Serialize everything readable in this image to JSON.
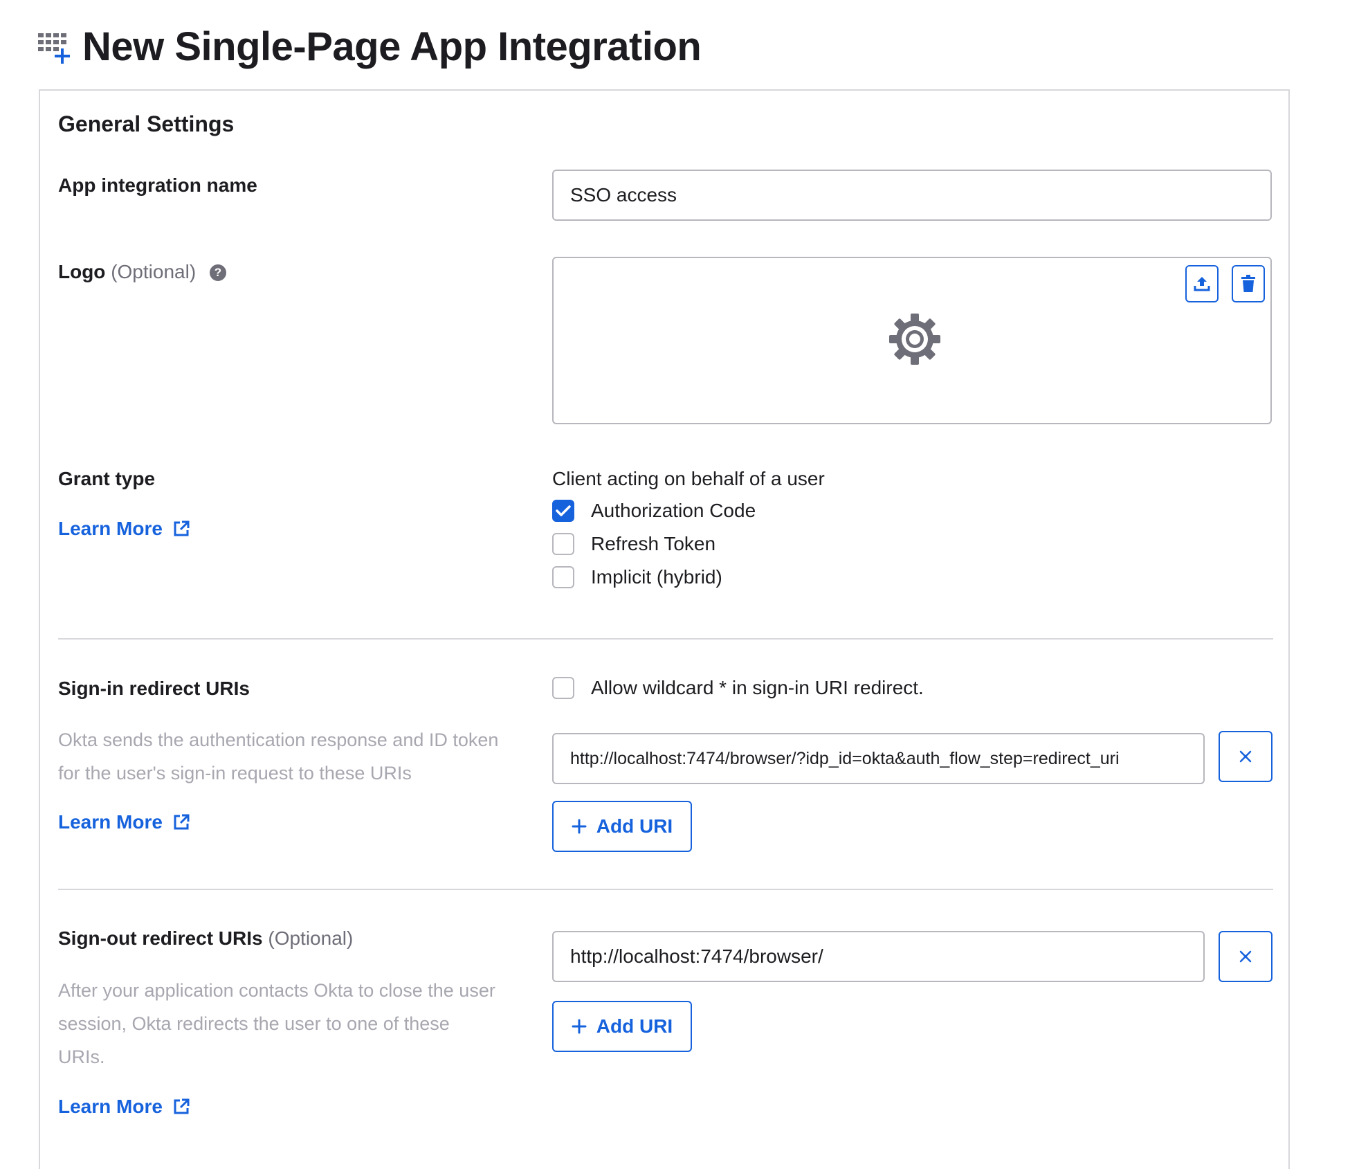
{
  "header": {
    "title": "New Single-Page App Integration",
    "icon": "apps-add-icon"
  },
  "general": {
    "section_title": "General Settings",
    "app_name": {
      "label": "App integration name",
      "value": "SSO access"
    },
    "logo": {
      "label": "Logo",
      "optional": "(Optional)",
      "help_icon": "?",
      "upload_icon": "upload-icon",
      "delete_icon": "trash-icon",
      "placeholder_icon": "gear-icon"
    },
    "grant_type": {
      "label": "Grant type",
      "learn_more": "Learn More",
      "group_label": "Client acting on behalf of a user",
      "options": [
        {
          "label": "Authorization Code",
          "checked": true
        },
        {
          "label": "Refresh Token",
          "checked": false
        },
        {
          "label": "Implicit (hybrid)",
          "checked": false
        }
      ]
    },
    "sign_in": {
      "label": "Sign-in redirect URIs",
      "description": "Okta sends the authentication response and ID token for the user's sign-in request to these URIs",
      "learn_more": "Learn More",
      "wildcard_label": "Allow wildcard * in sign-in URI redirect.",
      "wildcard_checked": false,
      "uri_value": "http://localhost:7474/browser/?idp_id=okta&auth_flow_step=redirect_uri",
      "add_label": "Add URI"
    },
    "sign_out": {
      "label": "Sign-out redirect URIs",
      "optional": "(Optional)",
      "description": "After your application contacts Okta to close the user session, Okta redirects the user to one of these URIs.",
      "learn_more": "Learn More",
      "uri_value": "http://localhost:7474/browser/",
      "add_label": "Add URI"
    }
  },
  "colors": {
    "accent": "#1662dd",
    "border": "#b7b7bd",
    "muted_text": "#a7a7b0"
  }
}
